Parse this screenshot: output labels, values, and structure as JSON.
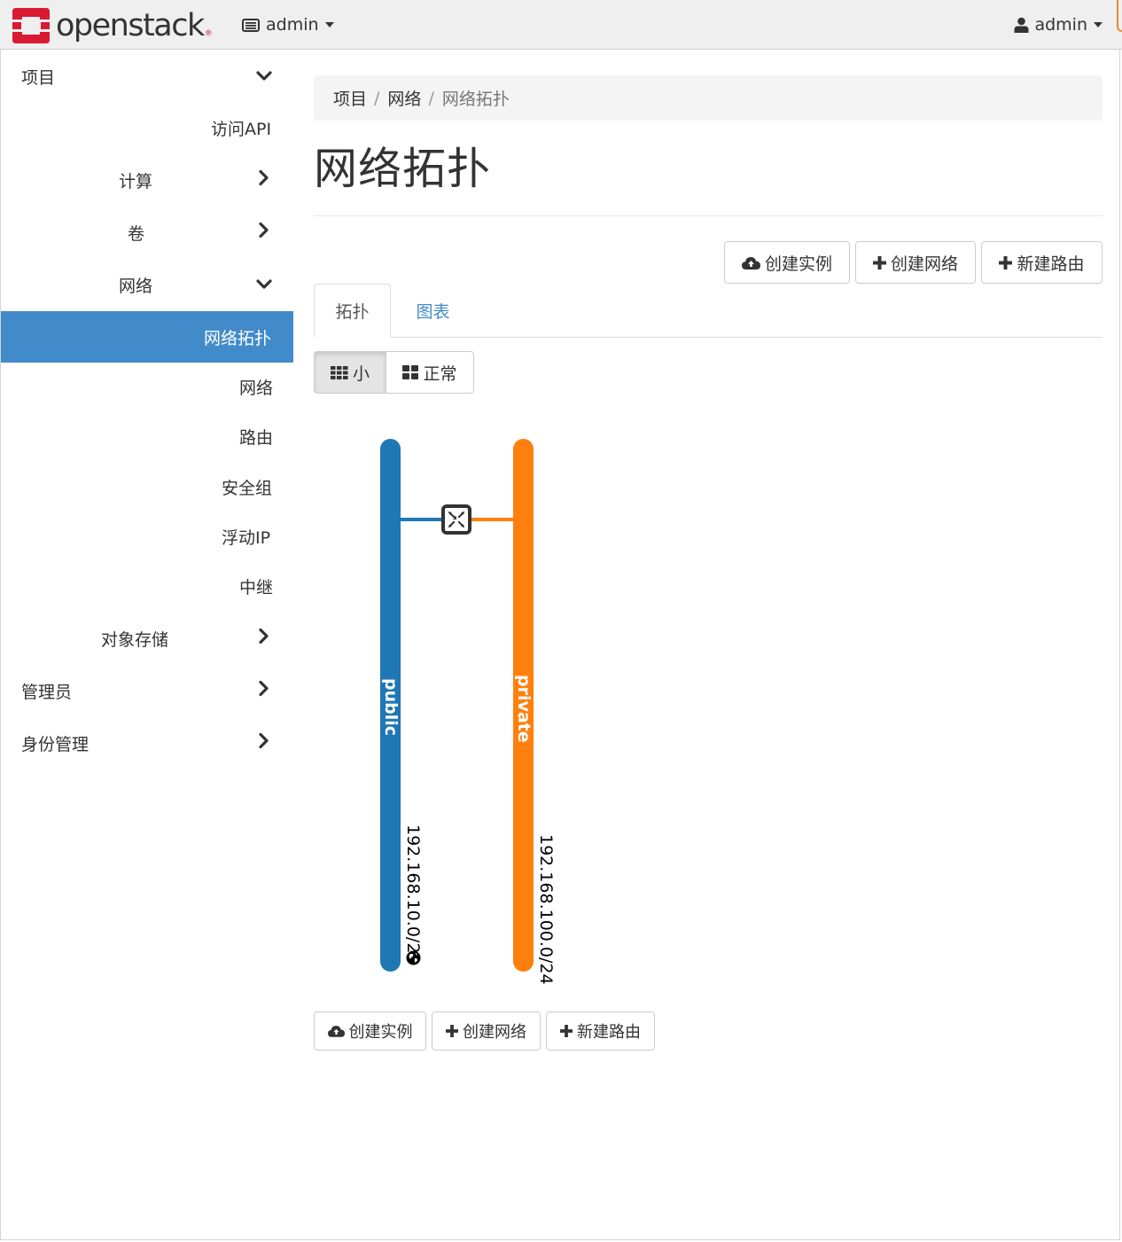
{
  "header": {
    "brand": "openstack",
    "brand_reg": "®",
    "project_selector": "admin",
    "user_menu": "admin"
  },
  "sidebar": {
    "project": "项目",
    "access_api": "访问API",
    "compute": "计算",
    "volumes": "卷",
    "network": "网络",
    "network_topology": "网络拓扑",
    "networks": "网络",
    "routers": "路由",
    "security_groups": "安全组",
    "floating_ips": "浮动IP",
    "trunks": "中继",
    "object_store": "对象存储",
    "admin": "管理员",
    "identity": "身份管理"
  },
  "breadcrumb": {
    "items": [
      "项目",
      "网络",
      "网络拓扑"
    ],
    "sep": "/"
  },
  "page": {
    "title": "网络拓扑"
  },
  "actions": {
    "launch_instance": "创建实例",
    "create_network": "创建网络",
    "create_router": "新建路由"
  },
  "tabs": {
    "topology": "拓扑",
    "graph": "图表"
  },
  "view_toggle": {
    "small": "小",
    "normal": "正常",
    "selected": "small"
  },
  "topology": {
    "networks": [
      {
        "name": "public",
        "cidr": "192.168.10.0/24",
        "color": "#1f77b4",
        "external": true
      },
      {
        "name": "private",
        "cidr": "192.168.100.0/24",
        "color": "#ff7f0e",
        "external": false
      }
    ],
    "router_connects": [
      "public",
      "private"
    ]
  },
  "colors": {
    "accent": "#428bca",
    "link": "#428bca",
    "brand_red": "#da1a32"
  }
}
